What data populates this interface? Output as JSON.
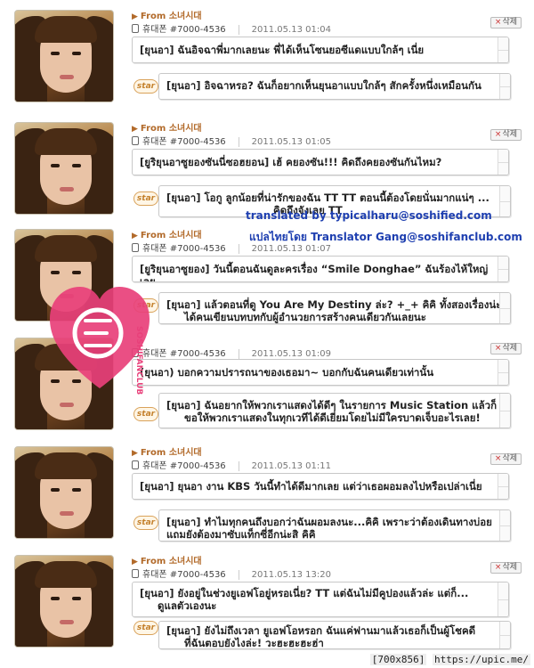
{
  "comments": [
    {
      "from": "From 소녀시대",
      "sender": "휴대폰 #7000-4536",
      "date": "2011.05.13 01:04",
      "delete_label": "삭제",
      "question": "[ยุนอา] ฉันอิจฉาพี่มากเลยนะ พี่ได้เห็นโซนยอซีแดแบบใกล้ๆ เนี่ย",
      "star_label": "star",
      "answer_line1": "[ยุนอา] อิจฉาหรอ? ฉันก็อยากเห็นยุนอาแบบใกล้ๆ สักครั้งหนึ่งเหมือนกัน",
      "answer_line2": ""
    },
    {
      "from": "From 소녀시대",
      "sender": "휴대폰 #7000-4536",
      "date": "2011.05.13 01:05",
      "delete_label": "삭제",
      "question": "[ยูริยุนอาซูยองซันนี่ซอฮยอน] เฮ้ คยองซัน!!! คิดถึงคยองซันกันไหม?",
      "star_label": "star",
      "answer_line1": "[ยุนอา] โอกู ลูกน้อยที่น่ารักของฉัน TT TT ตอนนี้ต้องโดยนั่นมากแน่ๆ ...",
      "answer_line2": "คิดถึงจังเลย TT"
    },
    {
      "from": "From 소녀시대",
      "sender": "휴대폰 #7000-4536",
      "date": "2011.05.13 01:07",
      "delete_label": "삭제",
      "question": "[ยูริยุนอาซูยอง] วันนี้ตอนฉันดูละครเรื่อง “Smile Donghae” ฉันร้องไห้ใหญ่เลย",
      "star_label": "star",
      "answer_line1": "[ยุนอา] แล้วตอนที่ดู You Are My Destiny ล่ะ? +_+ คิคิ ทั้งสองเรื่องน่ะ",
      "answer_line2": "ได้คนเขียนบทบทกับผู้อำนวยการสร้างคนเดียวกันเลยนะ"
    },
    {
      "from": "From 소녀시대",
      "sender": "휴대폰 #7000-4536",
      "date": "2011.05.13 01:09",
      "delete_label": "삭제",
      "question": "(ยุนอา) บอกความปรารถนาของเธอมา~ บอกกับฉันคนเดียวเท่านั้น",
      "star_label": "star",
      "answer_line1": "[ยุนอา] ฉันอยากให้พวกเราแสดงได้ดีๆ ในรายการ Music Station แล้วก็",
      "answer_line2": "ขอให้พวกเราแสดงในทุกเวทีได้ดีเยี่ยมโดยไม่มีใครบาดเจ็บอะไรเลย!"
    },
    {
      "from": "From 소녀시대",
      "sender": "휴대폰 #7000-4536",
      "date": "2011.05.13 01:11",
      "delete_label": "삭제",
      "question": "[ยุนอา] ยุนอา งาน KBS วันนี้ทำได้ดีมากเลย แต่ว่าเธอผอมลงไปหรือเปล่าเนี่ย",
      "star_label": "star",
      "answer_line1": "[ยุนอา] ทำไมทุกคนถึงบอกว่าฉันผอมลงนะ...คิคิ เพราะว่าต้องเดินทางบ่อย",
      "answer_line2": "แถมยังต้องมาซับแท็กซี่อีกน่ะสิ คิคิ"
    },
    {
      "from": "From 소녀시대",
      "sender": "휴대폰 #7000-4536",
      "date": "2011.05.13 13:20",
      "delete_label": "삭제",
      "question": "[ยุนอา] ยังอยู่ในช่วงยูเอฟโอยู่หรอเนี่ย? TT แต่ฉันไม่มีคูปองแล้วล่ะ แต่ก็...",
      "question_line2": "ดูแลตัวเองนะ",
      "star_label": "star",
      "answer_line1": "[ยุนอา] ยังไม่ถึงเวลา ยูเอฟโอหรอก ฉันแค่ฟานมาแล้วเธอก็เป็นผู้โชคดี",
      "answer_line2": "ที่ฉันตอบยังไงล่ะ! วะฮะฮะฮะฮ่า"
    }
  ],
  "credits": {
    "line1": "translated by typicalharu@soshified.com",
    "line2": "แปลไทยโดย Translator Gang@soshifanclub.com"
  },
  "watermark": {
    "text": "SOSHIFANCLUB",
    "color": "#e8407a"
  },
  "footer": {
    "dimensions": "[700x856]",
    "site": "https://upic.me/"
  }
}
